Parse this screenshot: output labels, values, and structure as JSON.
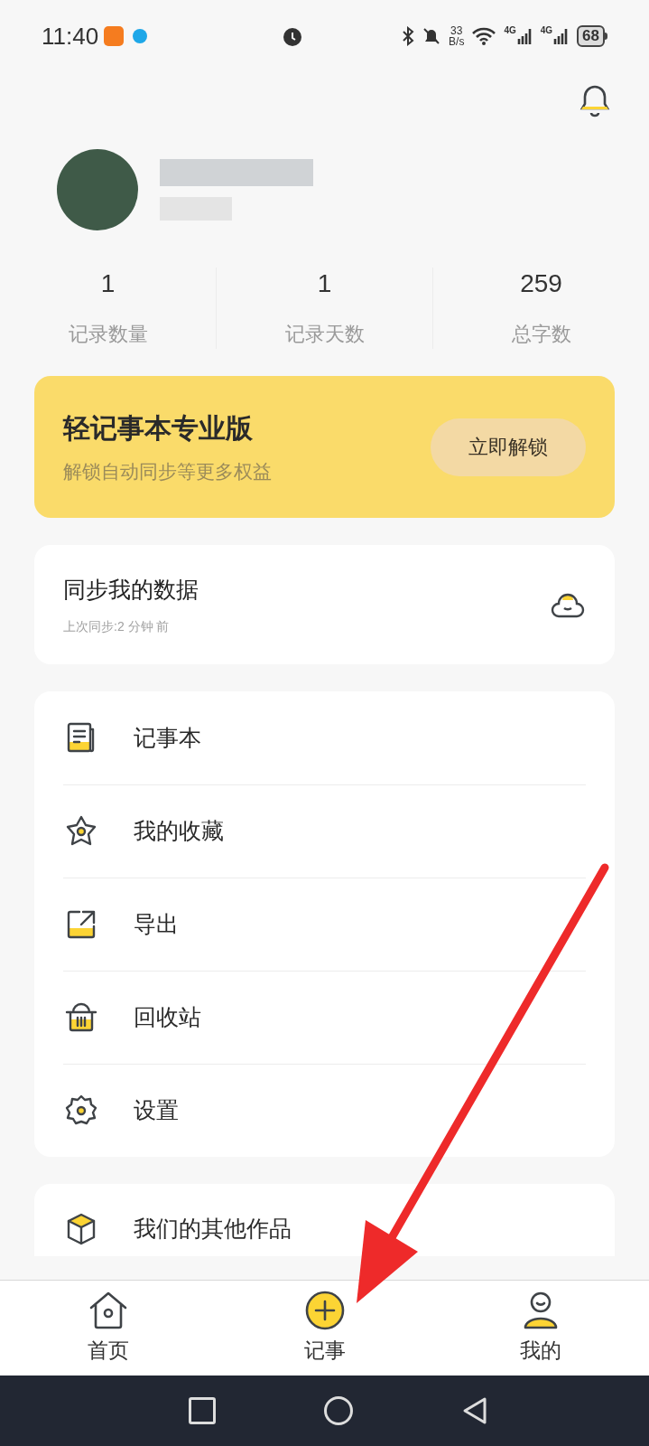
{
  "status_bar": {
    "time": "11:40",
    "speed_value": "33",
    "speed_unit": "B/s",
    "network_1": "4G",
    "network_2": "4G",
    "battery": "68"
  },
  "stats": [
    {
      "value": "1",
      "label": "记录数量"
    },
    {
      "value": "1",
      "label": "记录天数"
    },
    {
      "value": "259",
      "label": "总字数"
    }
  ],
  "promo": {
    "title": "轻记事本专业版",
    "subtitle": "解锁自动同步等更多权益",
    "button": "立即解锁"
  },
  "sync": {
    "title": "同步我的数据",
    "subtitle": "上次同步:2 分钟 前"
  },
  "menu": [
    {
      "kind": "notebook",
      "label": "记事本"
    },
    {
      "kind": "favorite",
      "label": "我的收藏"
    },
    {
      "kind": "export",
      "label": "导出"
    },
    {
      "kind": "trash",
      "label": "回收站"
    },
    {
      "kind": "settings",
      "label": "设置"
    }
  ],
  "other": {
    "label": "我们的其他作品"
  },
  "tab_bar": [
    {
      "kind": "home",
      "label": "首页"
    },
    {
      "kind": "add",
      "label": "记事"
    },
    {
      "kind": "profile",
      "label": "我的"
    }
  ]
}
